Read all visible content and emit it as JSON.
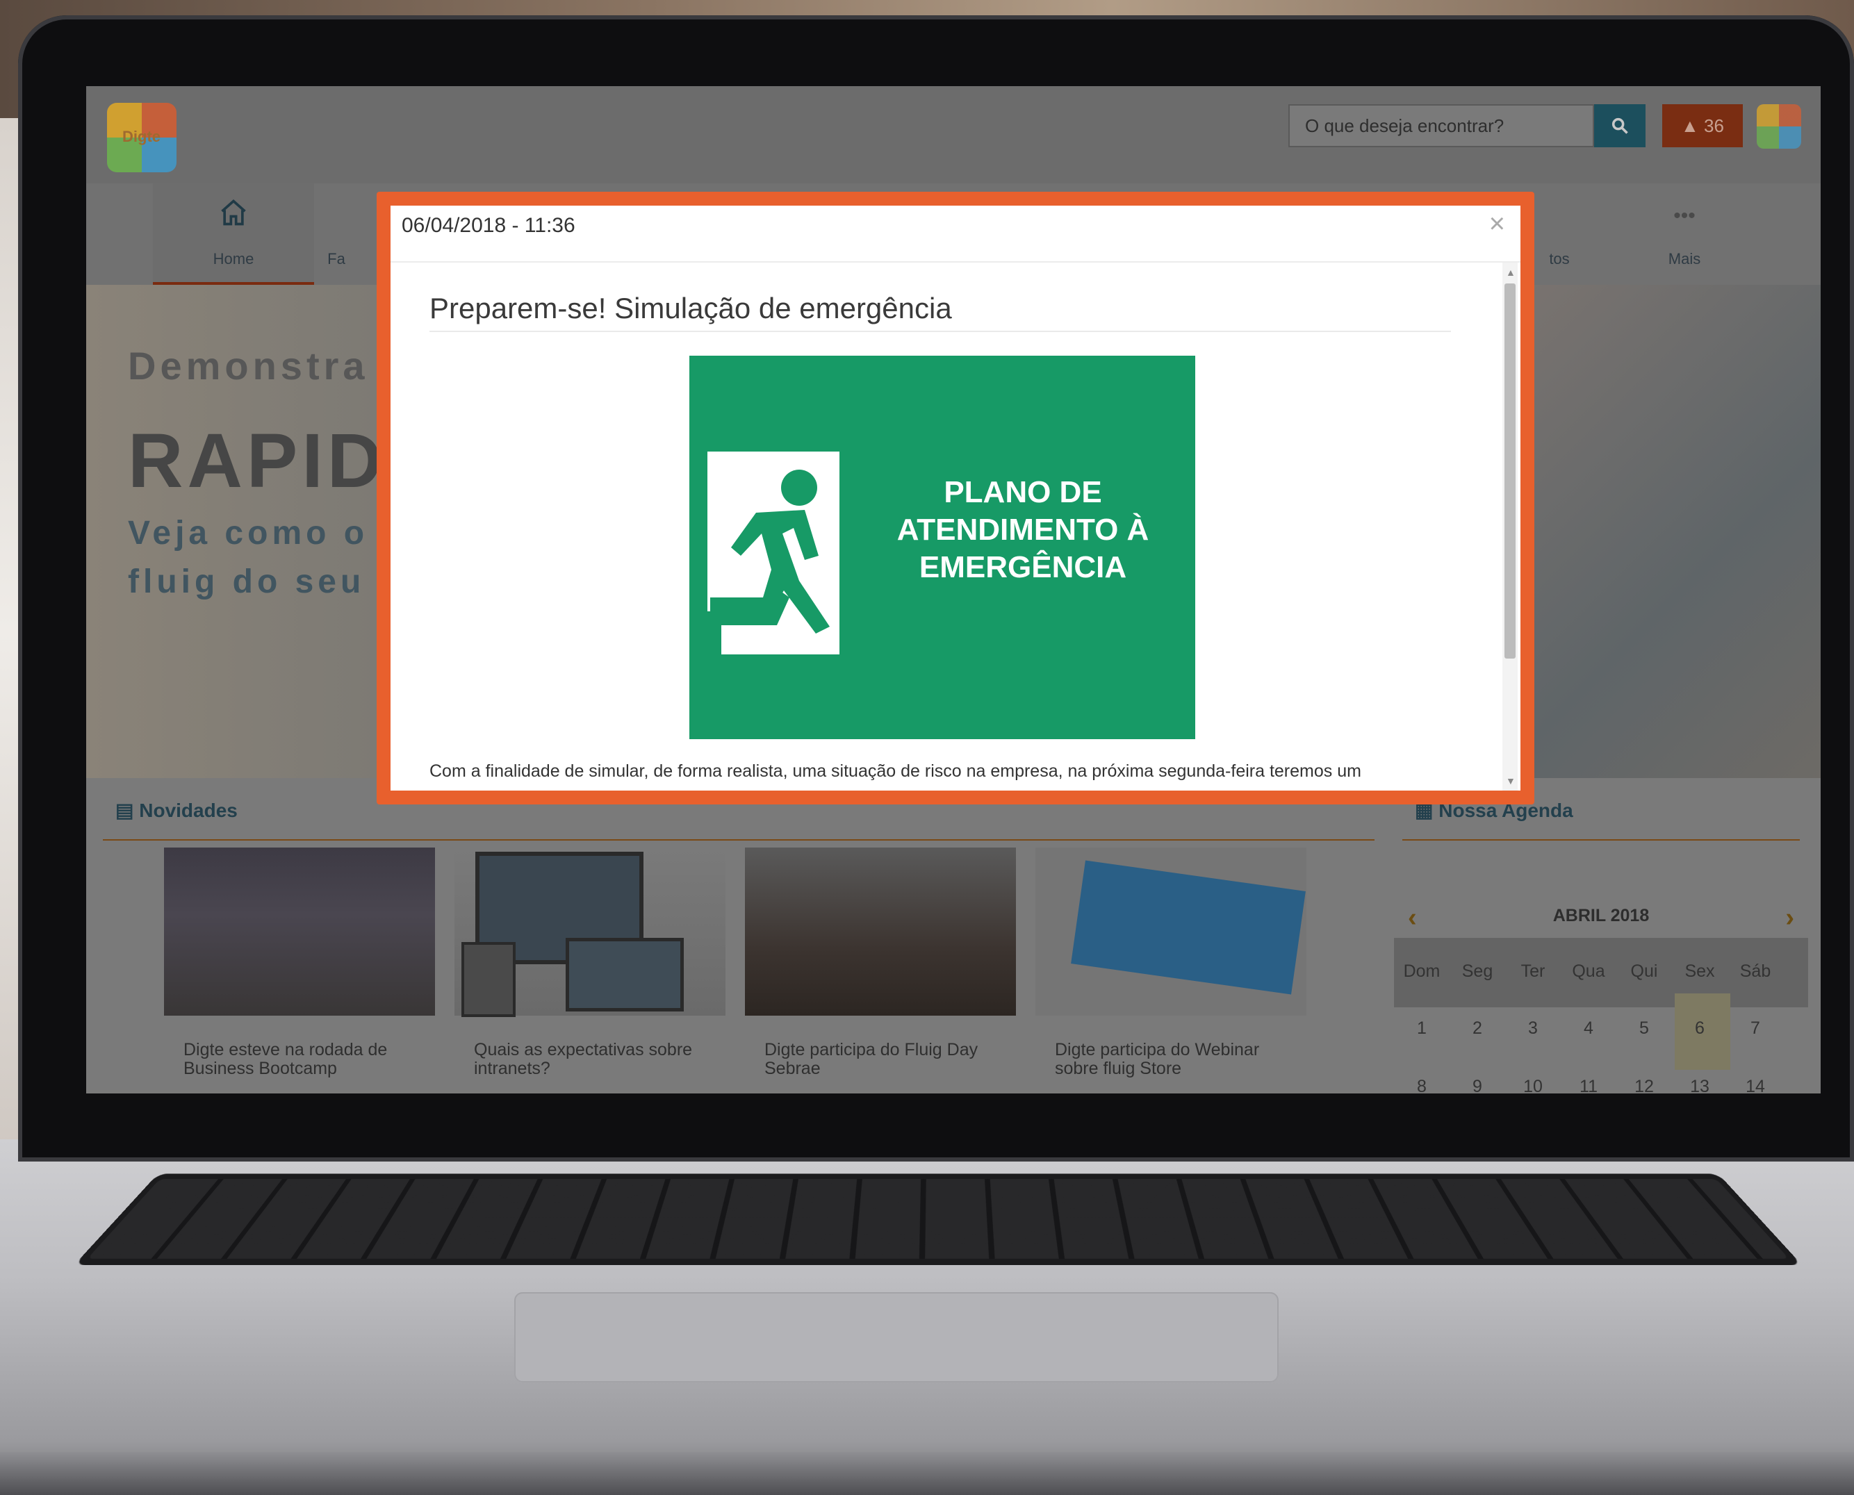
{
  "page": {
    "search_placeholder": "O que deseja encontrar?",
    "alert_count": "36",
    "logo_text": "Digte",
    "nav": {
      "home_label": "Home",
      "partial_label_1": "Fa",
      "partial_label_2": "tos",
      "more_label": "Mais"
    },
    "hero": {
      "line1": "Demonstra",
      "line2": "RAPID",
      "line3": "Veja como o",
      "line4": "fluig do seu"
    },
    "news": {
      "title": "Novidades",
      "items": [
        {
          "caption": "Digte esteve na rodada de Business Bootcamp"
        },
        {
          "caption": "Quais as expectativas sobre intranets?"
        },
        {
          "caption": "Digte participa do Fluig Day Sebrae"
        },
        {
          "caption": "Digte participa do Webinar sobre fluig Store"
        }
      ]
    },
    "agenda": {
      "title": "Nossa Agenda",
      "month": "ABRIL 2018",
      "weekdays": [
        "Dom",
        "Seg",
        "Ter",
        "Qua",
        "Qui",
        "Sex",
        "Sáb"
      ],
      "week1": [
        "1",
        "2",
        "3",
        "4",
        "5",
        "6",
        "7"
      ],
      "week2": [
        "8",
        "9",
        "10",
        "11",
        "12",
        "13",
        "14"
      ]
    }
  },
  "modal": {
    "date": "06/04/2018 - 11:36",
    "close": "×",
    "title": "Preparem-se! Simulação de emergência",
    "banner_text": "PLANO DE ATENDIMENTO À EMERGÊNCIA",
    "body_text": "Com a finalidade de simular, de forma realista, uma situação de risco na empresa, na próxima segunda-feira teremos um"
  },
  "colors": {
    "highlight_frame": "#e8602d",
    "banner_green": "#179a66"
  },
  "icons": [
    "search-icon",
    "warning-icon",
    "home-icon",
    "exit-sign-icon",
    "close-icon",
    "chevron-left-icon",
    "chevron-right-icon",
    "newspaper-icon",
    "calendar-icon"
  ]
}
